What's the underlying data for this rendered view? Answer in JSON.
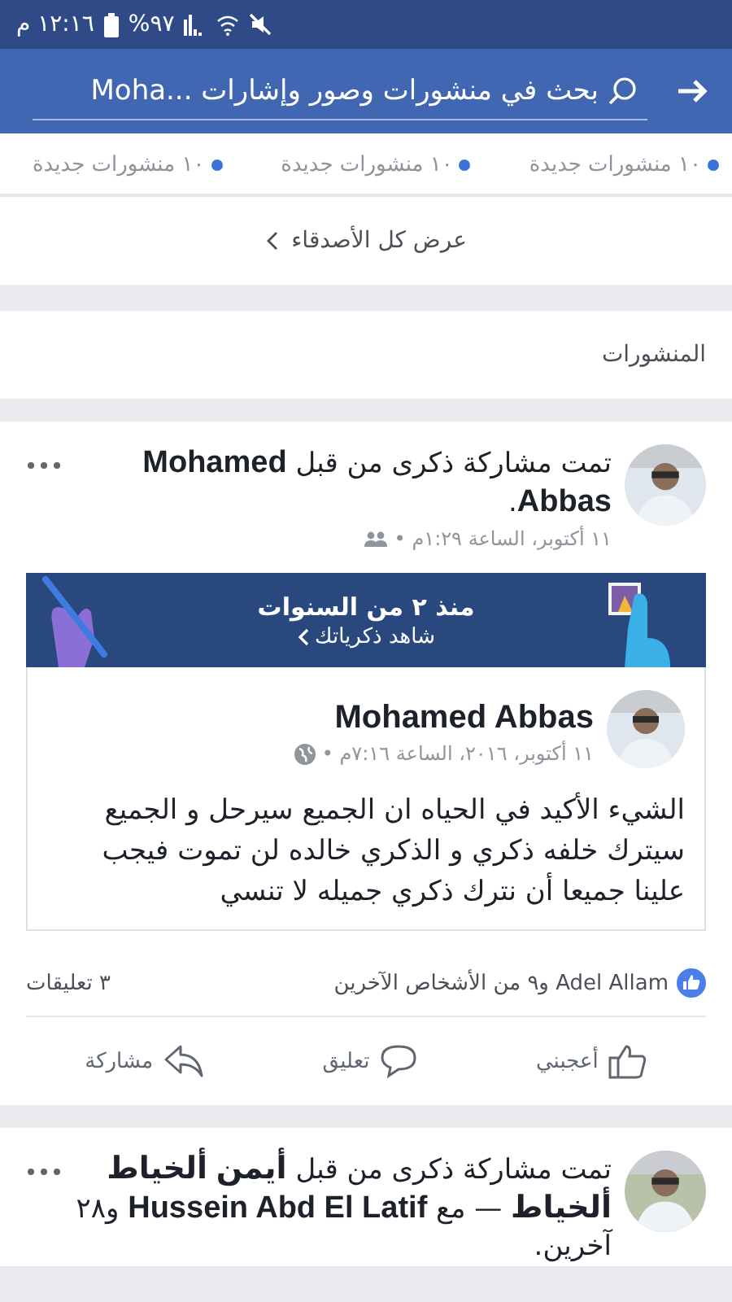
{
  "status_bar": {
    "time": "١٢:١٦ م",
    "battery": "%٩٧"
  },
  "search": {
    "placeholder": "بحث في منشورات وصور وإشارات ...Moha"
  },
  "friends": [
    {
      "new_posts": "١٠ منشورات جديدة"
    },
    {
      "new_posts": "١٠ منشورات جديدة"
    },
    {
      "new_posts": "١٠ منشورات جديدة"
    }
  ],
  "see_all": "عرض كل الأصدقاء",
  "section_title": "المنشورات",
  "posts": [
    {
      "header": "تمت مشاركة ذكرى من قبل **Mohamed Abbas**.",
      "time": "١١ أكتوبر، الساعة ١:٢٩م •",
      "memory": {
        "title": "منذ ٢ من السنوات",
        "link": "شاهد ذكرياتك",
        "author": "Mohamed Abbas",
        "time": "١١ أكتوبر، ٢٠١٦، الساعة ٧:١٦م •",
        "text": "الشيء الأكيد في الحياه ان الجميع سيرحل و الجميع سيترك خلفه ذكري و الذكري خالده لن تموت فيجب علينا جميعا أن نترك ذكري جميله لا تنسي"
      },
      "likes": "Adel Allam و٩ من الأشخاص الآخرين",
      "comments": "٣ تعليقات",
      "actions": [
        {
          "kind": "like",
          "label": "أعجبني"
        },
        {
          "kind": "comment",
          "label": "تعليق"
        },
        {
          "kind": "share",
          "label": "مشاركة"
        }
      ]
    },
    {
      "header": "تمت مشاركة ذكرى من قبل **أيمن ألخياط ألخياط** — مع **Hussein Abd El Latif** و٢٨ آخرين."
    }
  ]
}
